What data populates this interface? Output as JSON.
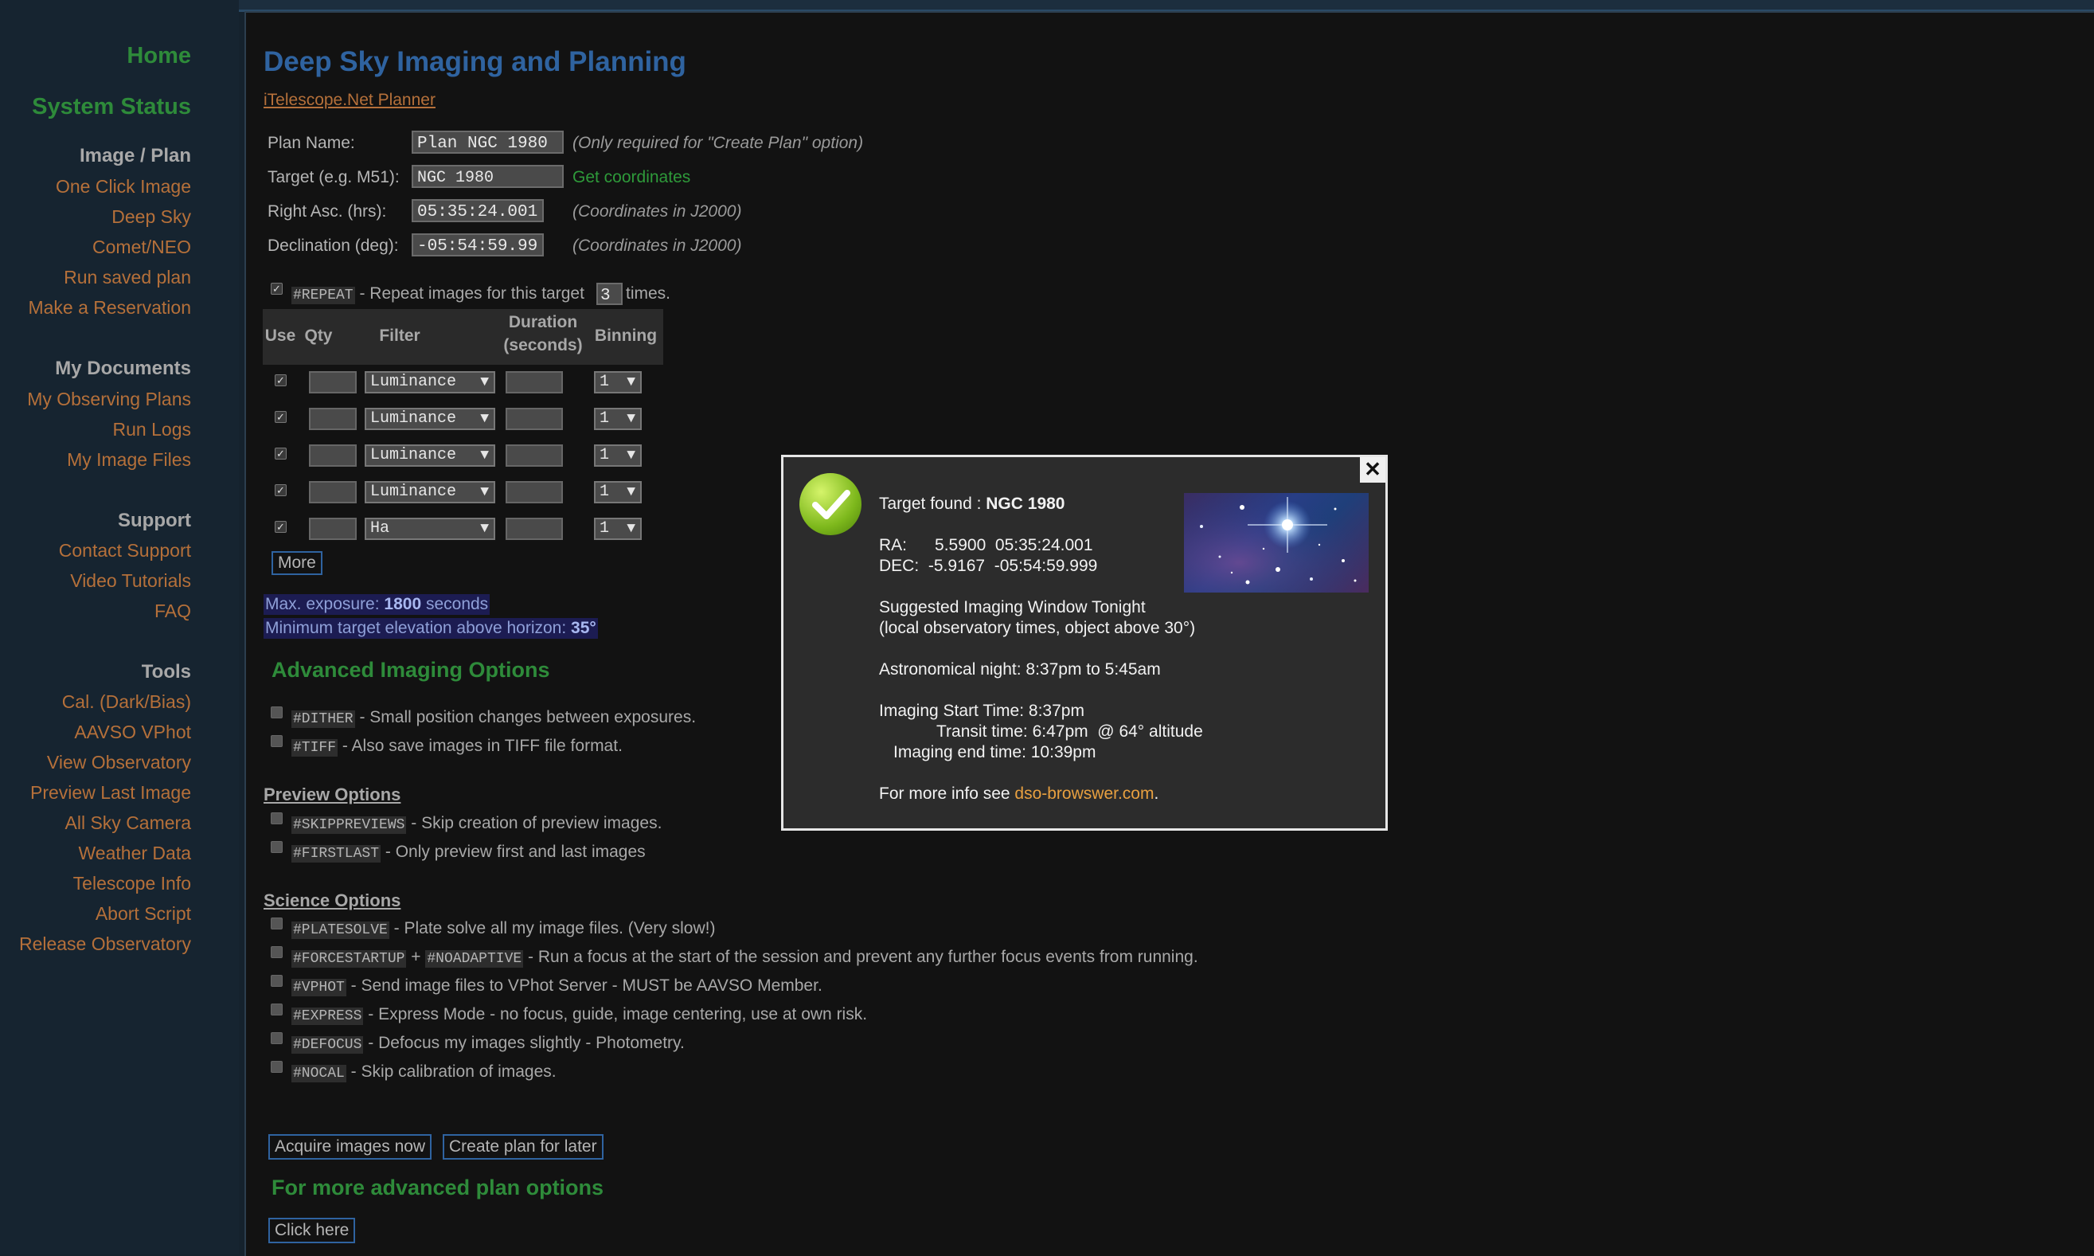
{
  "sidebar": {
    "home": "Home",
    "system_status": "System Status",
    "groups": [
      {
        "title": "Image / Plan",
        "items": [
          "One Click Image",
          "Deep Sky",
          "Comet/NEO",
          "Run saved plan",
          "Make a Reservation"
        ]
      },
      {
        "title": "My Documents",
        "items": [
          "My Observing Plans",
          "Run Logs",
          "My Image Files"
        ]
      },
      {
        "title": "Support",
        "items": [
          "Contact Support",
          "Video Tutorials",
          "FAQ"
        ]
      },
      {
        "title": "Tools",
        "items": [
          "Cal. (Dark/Bias)",
          "AAVSO VPhot",
          "View Observatory",
          "Preview Last Image",
          "All Sky Camera",
          "Weather Data",
          "Telescope Info",
          "Abort Script",
          "Release Observatory"
        ]
      }
    ]
  },
  "main": {
    "title": "Deep Sky Imaging and Planning",
    "planner_link": "iTelescope.Net Planner",
    "fields": {
      "plan_name": {
        "label": "Plan Name:",
        "value": "Plan NGC 1980",
        "note": "(Only required for \"Create Plan\" option)"
      },
      "target": {
        "label": "Target (e.g. M51):",
        "value": "NGC 1980",
        "action": "Get coordinates"
      },
      "ra": {
        "label": "Right Asc. (hrs):",
        "value": "05:35:24.001",
        "note": "(Coordinates in J2000)"
      },
      "dec": {
        "label": "Declination (deg):",
        "value": "-05:54:59.99",
        "note": "(Coordinates in J2000)"
      }
    },
    "repeat": {
      "code": "#REPEAT",
      "text_before": " - Repeat images for this target ",
      "value": "3",
      "text_after": " times."
    },
    "table": {
      "headers": {
        "use": "Use",
        "qty": "Qty",
        "filter": "Filter",
        "duration_line1": "Duration",
        "duration_line2": "(seconds)",
        "binning": "Binning"
      },
      "rows": [
        {
          "filter": "Luminance",
          "binning": "1"
        },
        {
          "filter": "Luminance",
          "binning": "1"
        },
        {
          "filter": "Luminance",
          "binning": "1"
        },
        {
          "filter": "Luminance",
          "binning": "1"
        },
        {
          "filter": "Ha",
          "binning": "1"
        }
      ],
      "more": "More"
    },
    "max_exposure": {
      "label": "Max. exposure: ",
      "value": "1800",
      "unit": " seconds"
    },
    "min_elevation": {
      "label": "Minimum target elevation above horizon: ",
      "value": "35°"
    },
    "advanced_title": "Advanced Imaging Options",
    "advanced": [
      {
        "code": "#DITHER",
        "text": " - Small position changes between exposures."
      },
      {
        "code": "#TIFF",
        "text": " - Also save images in TIFF file format."
      }
    ],
    "preview_title": "Preview Options",
    "preview": [
      {
        "code": "#SKIPPREVIEWS",
        "text": " - Skip creation of preview images."
      },
      {
        "code": "#FIRSTLAST",
        "text": " - Only preview first and last images"
      }
    ],
    "science_title": "Science Options",
    "science": [
      {
        "code": "#PLATESOLVE",
        "text": " - Plate solve all my image files. (Very slow!)"
      },
      {
        "code": "#FORCESTARTUP",
        "mid": " + ",
        "code2": "#NOADAPTIVE",
        "text": " - Run a focus at the start of the session and prevent any further focus events from running."
      },
      {
        "code": "#VPHOT",
        "text": " - Send image files to VPhot Server - MUST be AAVSO Member."
      },
      {
        "code": "#EXPRESS",
        "text": " - Express Mode - no focus, guide, image centering, use at own risk."
      },
      {
        "code": "#DEFOCUS",
        "text": " - Defocus my images slightly - Photometry."
      },
      {
        "code": "#NOCAL",
        "text": " - Skip calibration of images."
      }
    ],
    "buttons": {
      "acquire": "Acquire images now",
      "create": "Create plan for later",
      "click_here": "Click here"
    },
    "more_options_title": "For more advanced plan options"
  },
  "popup": {
    "close": "✕",
    "target_label": "Target found : ",
    "target_name": "NGC 1980",
    "ra_line": "RA:      5.5900  05:35:24.001",
    "dec_line": "DEC:  -5.9167  -05:54:59.999",
    "suggest_1": "Suggested Imaging Window Tonight",
    "suggest_2": "(local observatory times, object above 30°)",
    "astro_night": "Astronomical night: 8:37pm to 5:45am",
    "start_time": "Imaging Start Time: 8:37pm",
    "transit": "Transit time: 6:47pm  @ 64° altitude",
    "end_time": "Imaging end time: 10:39pm",
    "more_info": "For more info see ",
    "link": "dso-browswer.com",
    "period": "."
  }
}
